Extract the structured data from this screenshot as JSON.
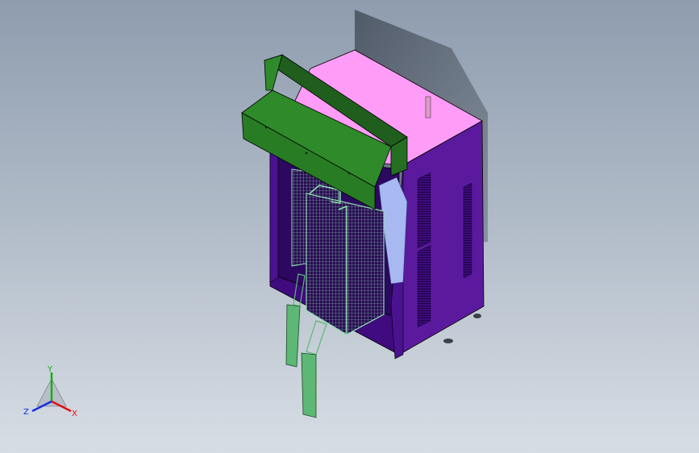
{
  "viewport": {
    "background_top": "#8e9cae",
    "background_bottom": "#d7dde4"
  },
  "model": {
    "cabinet_front_color": "#3f0b7e",
    "cabinet_side_color": "#5b1a9e",
    "cabinet_top_color": "#ff9cf7",
    "hood_color": "#2f8a2a",
    "hood_dark_color": "#1f5e1c",
    "mesh_color": "#8fe0b0",
    "duct_color": "#5cb874"
  },
  "triad": {
    "x_label": "X",
    "y_label": "Y",
    "z_label": "Z",
    "x_color": "#e01010",
    "y_color": "#10b010",
    "z_color": "#1030e0"
  }
}
